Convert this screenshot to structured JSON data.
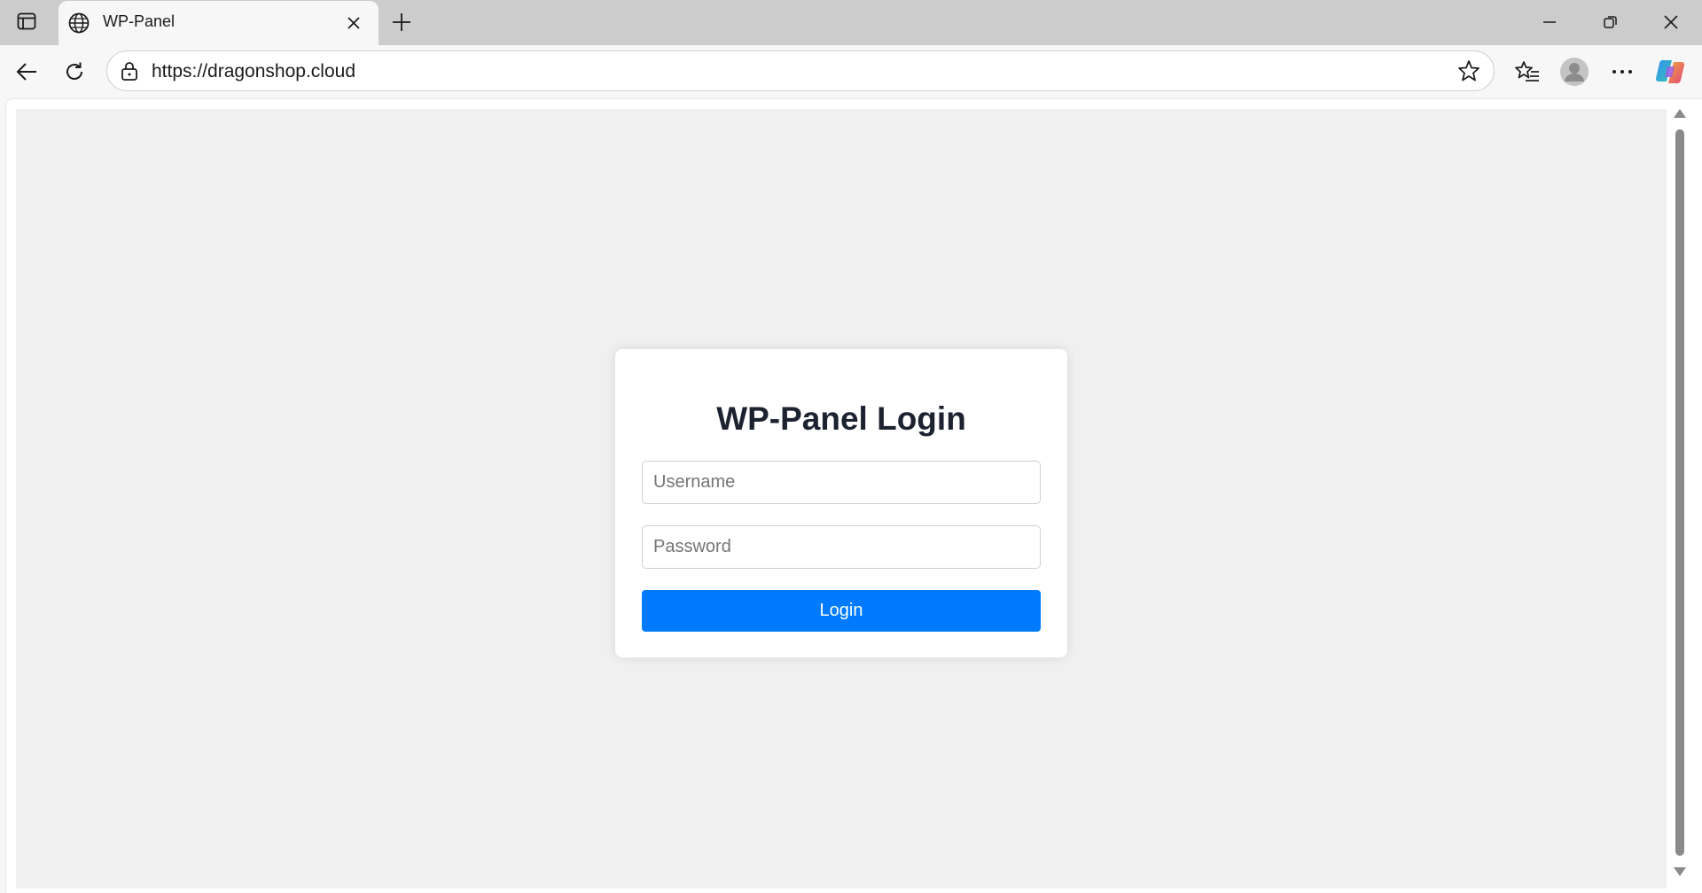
{
  "browser": {
    "tab": {
      "title": "WP-Panel",
      "favicon": "globe-icon"
    },
    "address_bar": {
      "url": "https://dragonshop.cloud"
    },
    "icons": {
      "tab_actions": "tab-actions-icon",
      "close_tab": "close-icon",
      "new_tab": "plus-icon",
      "minimize": "minimize-icon",
      "restore": "restore-icon",
      "close_window": "close-icon",
      "back": "back-arrow-icon",
      "reload": "reload-icon",
      "site_info": "lock-icon",
      "favorite": "star-icon",
      "favorites_list": "favorites-icon",
      "profile": "profile-icon",
      "more": "more-icon",
      "copilot": "copilot-icon"
    }
  },
  "page": {
    "background": "#f0f0f0",
    "login": {
      "title": "WP-Panel Login",
      "username_placeholder": "Username",
      "username_value": "",
      "password_placeholder": "Password",
      "password_value": "",
      "button_label": "Login",
      "button_color": "#007bff"
    }
  }
}
